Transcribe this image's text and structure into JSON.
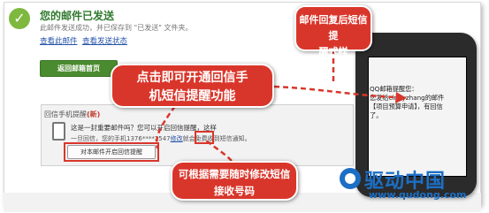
{
  "status": {
    "title": "您的邮件已发送",
    "subtitle": "此邮件发送成功，并已保存到 \"已发送\" 文件夹。",
    "link_view": "查看此邮件",
    "link_status": "查看发送状态",
    "back_button": "返回邮箱首页"
  },
  "reminder_panel": {
    "title": "回信手机提醒",
    "new_tag": "(新)",
    "question": "这是一封重要邮件吗？您可以开启回信提醒，这样",
    "detail_prefix": "一旦回信，您的手机1376****2547",
    "modify_link": "修改",
    "detail_suffix": "就会免费收到短信通知。",
    "open_button": "对本邮件开启回信提醒"
  },
  "callouts": {
    "click_open": [
      "点击即可开通回信手",
      "机短信提醒功能"
    ],
    "modify_number": [
      "可根据需要随时修改短信",
      "接收号码"
    ],
    "sms_style": [
      "邮件回复后短信提",
      "醒式样"
    ]
  },
  "phone_sms": [
    "QQ邮箱提醒您：",
    "您发给cindyzhang的邮件",
    "【项目预算申请】，有回信",
    "了。"
  ],
  "watermark": {
    "brand": "驱动中国",
    "url": "www.qudong.com"
  },
  "colors": {
    "accent_red": "#d9362b",
    "success_green": "#4b8b2f",
    "link_blue": "#2653a8",
    "brand_blue": "#1c6fc5"
  }
}
